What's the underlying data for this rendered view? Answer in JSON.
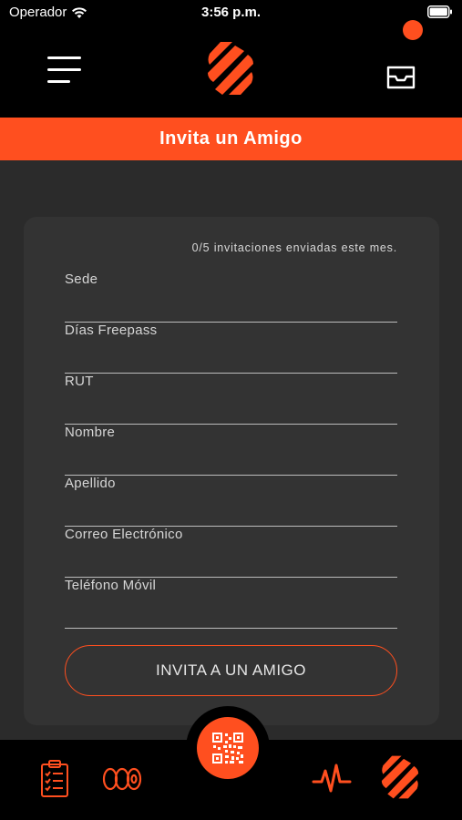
{
  "status_bar": {
    "carrier": "Operador",
    "time": "3:56 p.m."
  },
  "header": {
    "menu_icon": "hamburger-menu-icon",
    "logo_icon": "brand-logo-icon",
    "inbox_icon": "inbox-tray-icon",
    "has_notification": true
  },
  "title": "Invita un Amigo",
  "form": {
    "invite_count": "0/5 invitaciones enviadas este mes.",
    "fields": [
      {
        "label": "Sede",
        "value": ""
      },
      {
        "label": "Días Freepass",
        "value": ""
      },
      {
        "label": "RUT",
        "value": ""
      },
      {
        "label": "Nombre",
        "value": ""
      },
      {
        "label": "Apellido",
        "value": ""
      },
      {
        "label": "Correo Electrónico",
        "value": ""
      },
      {
        "label": "Teléfono Móvil",
        "value": ""
      }
    ],
    "submit_label": "INVITA A UN AMIGO"
  },
  "bottom_nav": {
    "items": [
      {
        "icon": "clipboard-checklist-icon"
      },
      {
        "icon": "weight-plates-icon"
      },
      {
        "icon": "qr-code-icon"
      },
      {
        "icon": "activity-pulse-icon"
      },
      {
        "icon": "brand-logo-icon"
      }
    ]
  },
  "colors": {
    "accent": "#ff4f1f",
    "background": "#2b2b2b",
    "card": "#333333",
    "bar": "#000000"
  }
}
